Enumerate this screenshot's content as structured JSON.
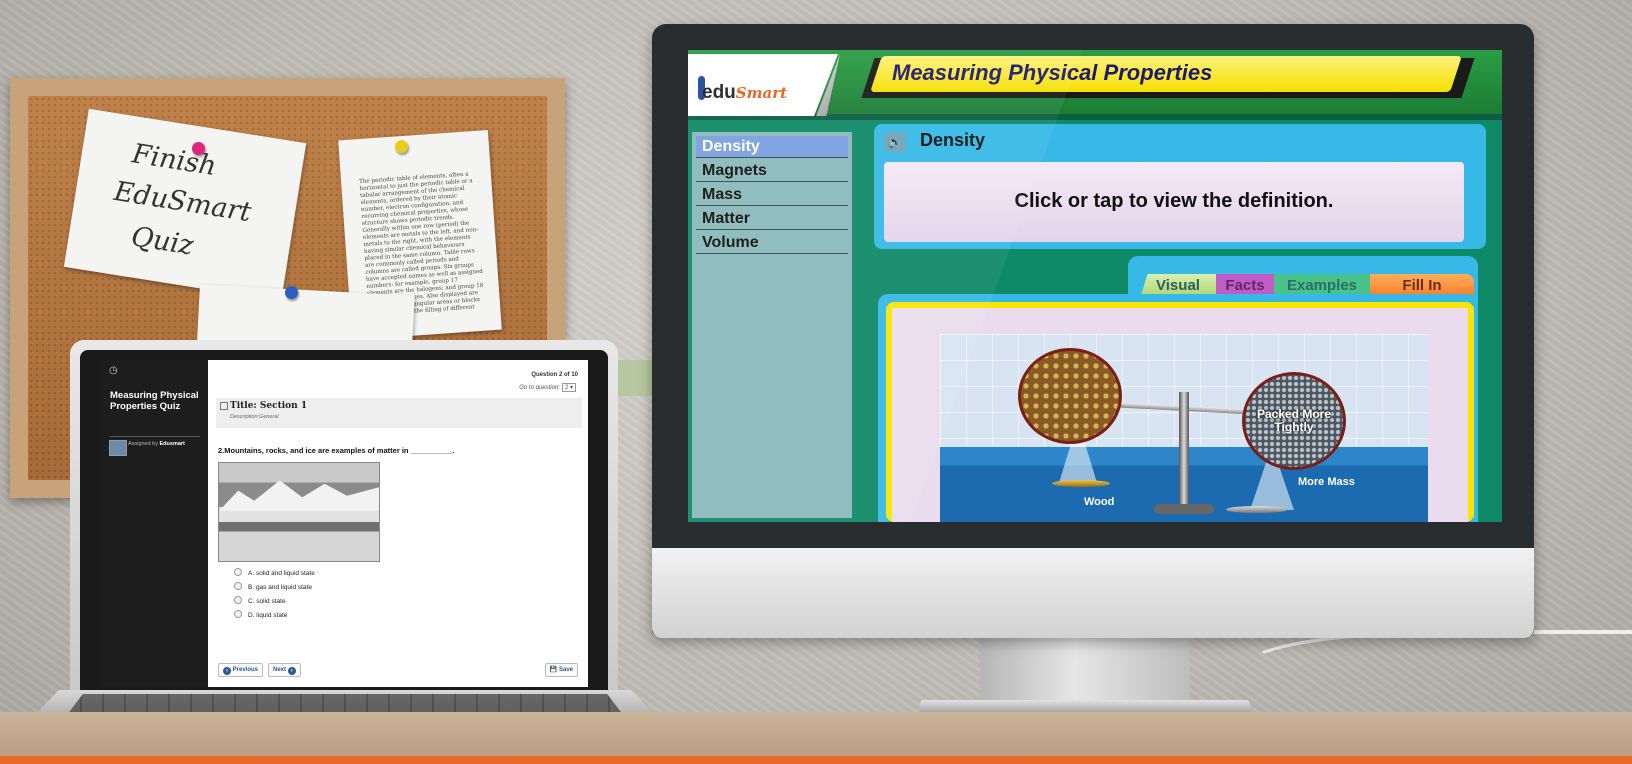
{
  "note_handwritten": [
    "Finish",
    "EduSmart",
    "Quiz"
  ],
  "note_printed": "The periodic table of elements, often a horizontal to just the periodic table or a tabular arrangement of the chemical elements, ordered by their atomic number, electron configuration, and recurring chemical properties, whose structure shows periodic trends. Generally within one row (period) the elements are metals to the left, and non-metals to the right, with the elements having similar chemical behaviours placed in the same column. Table rows are commonly called periods and columns are called groups. Six groups have accepted names as well as assigned numbers: for example, group 17 elements are the halogens; and group 18 are the noble gases. Also displayed are four simple rectangular areas or blocks associated with the filling of different atomic orbitals.",
  "quiz": {
    "title": "Measuring Physical Properties Quiz",
    "assigned_prefix": "Assigned by",
    "assigned_by": "Edusmart",
    "question_counter": "Question 2 of 10",
    "goto_label": "Go to question:",
    "goto_value": "2",
    "section_title": "Title: Section 1",
    "section_description": "Description:General",
    "question_text": "2.Mountains, rocks, and ice are examples of matter in __________.",
    "options": [
      "A.  solid and liquid state",
      "B.  gas and liquid state",
      "C.  solid state",
      "D.  liquid state"
    ],
    "prev_label": "Previous",
    "next_label": "Next",
    "save_label": "Save"
  },
  "app": {
    "logo_edu": "edu",
    "logo_smart": "Smart",
    "title": "Measuring Physical Properties",
    "nav": [
      "Density",
      "Magnets",
      "Mass",
      "Matter",
      "Volume"
    ],
    "active_nav": "Density",
    "card_title": "Density",
    "definition_prompt": "Click or tap to view the definition.",
    "tabs": [
      "Visual",
      "Facts",
      "Examples",
      "Fill In"
    ],
    "scene_circle_label": "Packed More Tightly",
    "scene_label_right": "More Mass",
    "scene_label_left": "Wood"
  },
  "colors": {
    "accent_orange": "#e8692a",
    "app_green": "#1b7a33",
    "title_yellow": "#f5df00",
    "nav_active": "#7a9ee0",
    "panel_blue": "#36b9e6"
  }
}
